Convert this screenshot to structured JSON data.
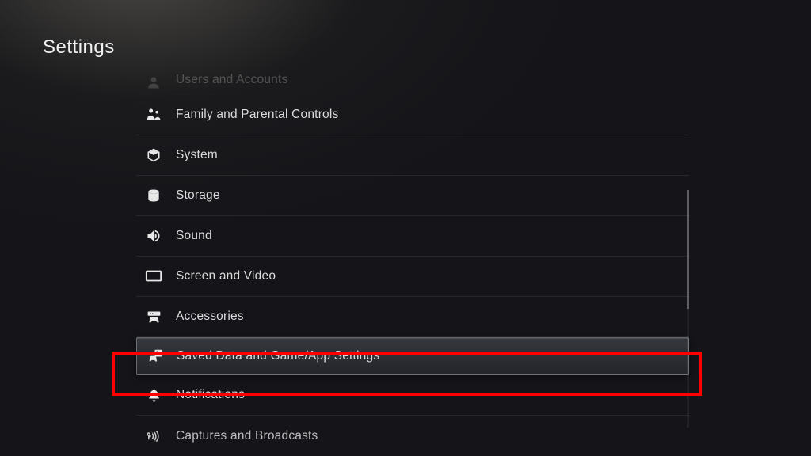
{
  "page": {
    "title": "Settings"
  },
  "menu": {
    "items": [
      {
        "label": "Users and Accounts",
        "icon": "user-icon",
        "dim": true
      },
      {
        "label": "Family and Parental Controls",
        "icon": "family-icon"
      },
      {
        "label": "System",
        "icon": "cube-icon"
      },
      {
        "label": "Storage",
        "icon": "storage-icon"
      },
      {
        "label": "Sound",
        "icon": "speaker-icon"
      },
      {
        "label": "Screen and Video",
        "icon": "screen-icon"
      },
      {
        "label": "Accessories",
        "icon": "controller-icon"
      },
      {
        "label": "Saved Data and Game/App Settings",
        "icon": "saved-data-icon",
        "selected": true,
        "highlighted": true
      },
      {
        "label": "Notifications",
        "icon": "bell-icon"
      },
      {
        "label": "Captures and Broadcasts",
        "icon": "broadcast-icon",
        "cutoff": true
      }
    ]
  },
  "highlight": {
    "color": "#ff0000"
  }
}
